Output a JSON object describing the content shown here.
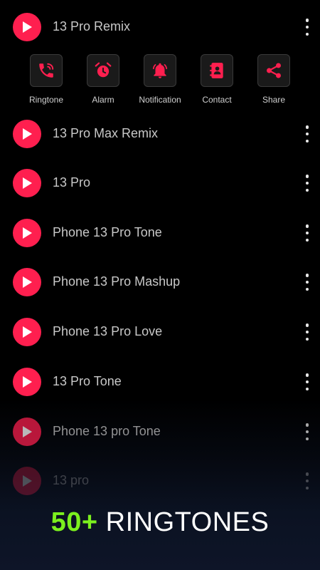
{
  "songs": [
    {
      "title": "13 Pro Remix"
    },
    {
      "title": "13 Pro Max Remix"
    },
    {
      "title": "13 Pro"
    },
    {
      "title": "Phone 13 Pro Tone"
    },
    {
      "title": "Phone 13 Pro Mashup"
    },
    {
      "title": "Phone 13 Pro Love"
    },
    {
      "title": "13 Pro Tone"
    },
    {
      "title": "Phone 13 pro Tone"
    },
    {
      "title": "13 pro"
    }
  ],
  "actions": [
    {
      "label": "Ringtone",
      "icon": "phone-ringing-icon"
    },
    {
      "label": "Alarm",
      "icon": "alarm-clock-icon"
    },
    {
      "label": "Notification",
      "icon": "bell-icon"
    },
    {
      "label": "Contact",
      "icon": "contact-book-icon"
    },
    {
      "label": "Share",
      "icon": "share-icon"
    }
  ],
  "banner": {
    "count": "50+",
    "text": "RINGTONES"
  },
  "colors": {
    "accent": "#ff1f4f",
    "banner_accent": "#7cf01e",
    "background": "#000000"
  }
}
